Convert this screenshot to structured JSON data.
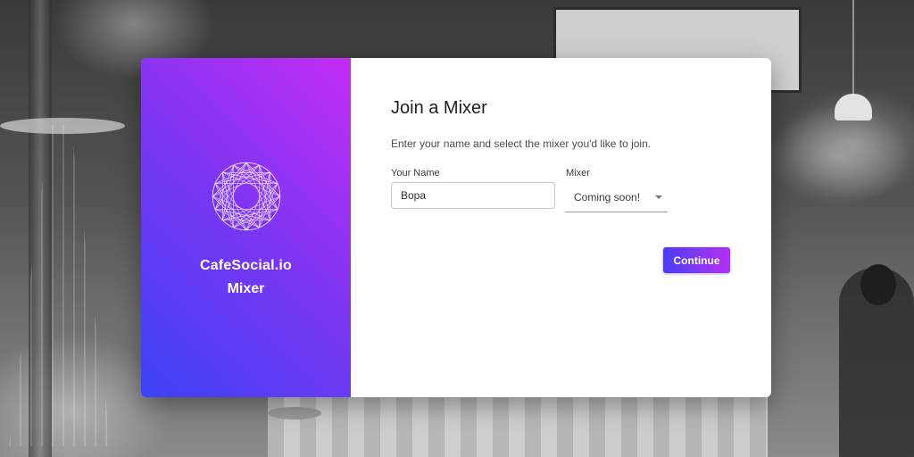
{
  "brand": {
    "name": "CafeSocial.io",
    "product": "Mixer",
    "logo_icon": "geometric-circle-icon",
    "gradient_start": "#3b42f5",
    "gradient_end": "#c42cf4"
  },
  "dialog": {
    "title": "Join a Mixer",
    "subtitle": "Enter your name and select the mixer you'd like to join."
  },
  "form": {
    "name_label": "Your Name",
    "name_value": "Bopa",
    "mixer_label": "Mixer",
    "mixer_value": "Coming soon!",
    "continue_label": "Continue"
  },
  "colors": {
    "accent": "#7a36f2",
    "button_start": "#4a3cf3",
    "button_end": "#b22ef3"
  }
}
